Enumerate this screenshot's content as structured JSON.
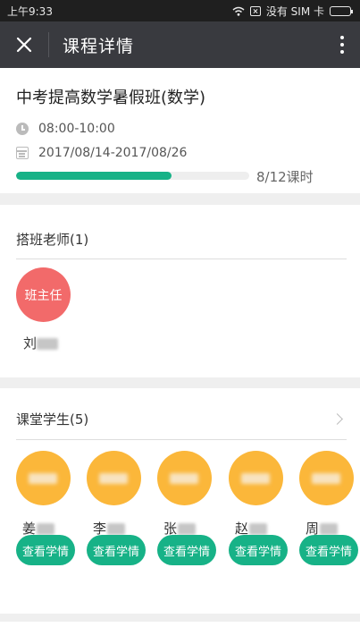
{
  "status_bar": {
    "time": "上午9:33",
    "carrier": "没有 SIM 卡"
  },
  "nav": {
    "title": "课程详情",
    "close_icon": "close-icon",
    "more_icon": "more-vertical-icon",
    "bg_color": "#393a3f"
  },
  "course": {
    "title": "中考提高数学暑假班(数学)",
    "time": "08:00-10:00",
    "dates": "2017/08/14-2017/08/26",
    "progress": {
      "done": 8,
      "total": 12,
      "text": "8/12课时",
      "color": "#17b287"
    }
  },
  "teachers": {
    "title": "搭班老师(1)",
    "items": [
      {
        "role": "班主任",
        "name_initial": "刘",
        "avatar_color": "#f26a6a"
      }
    ]
  },
  "students": {
    "title": "课堂学生(5)",
    "action_label": "查看学情",
    "avatar_color": "#fbb73a",
    "items": [
      {
        "name_initial": "姜"
      },
      {
        "name_initial": "李"
      },
      {
        "name_initial": "张"
      },
      {
        "name_initial": "赵"
      },
      {
        "name_initial": "周"
      }
    ]
  }
}
